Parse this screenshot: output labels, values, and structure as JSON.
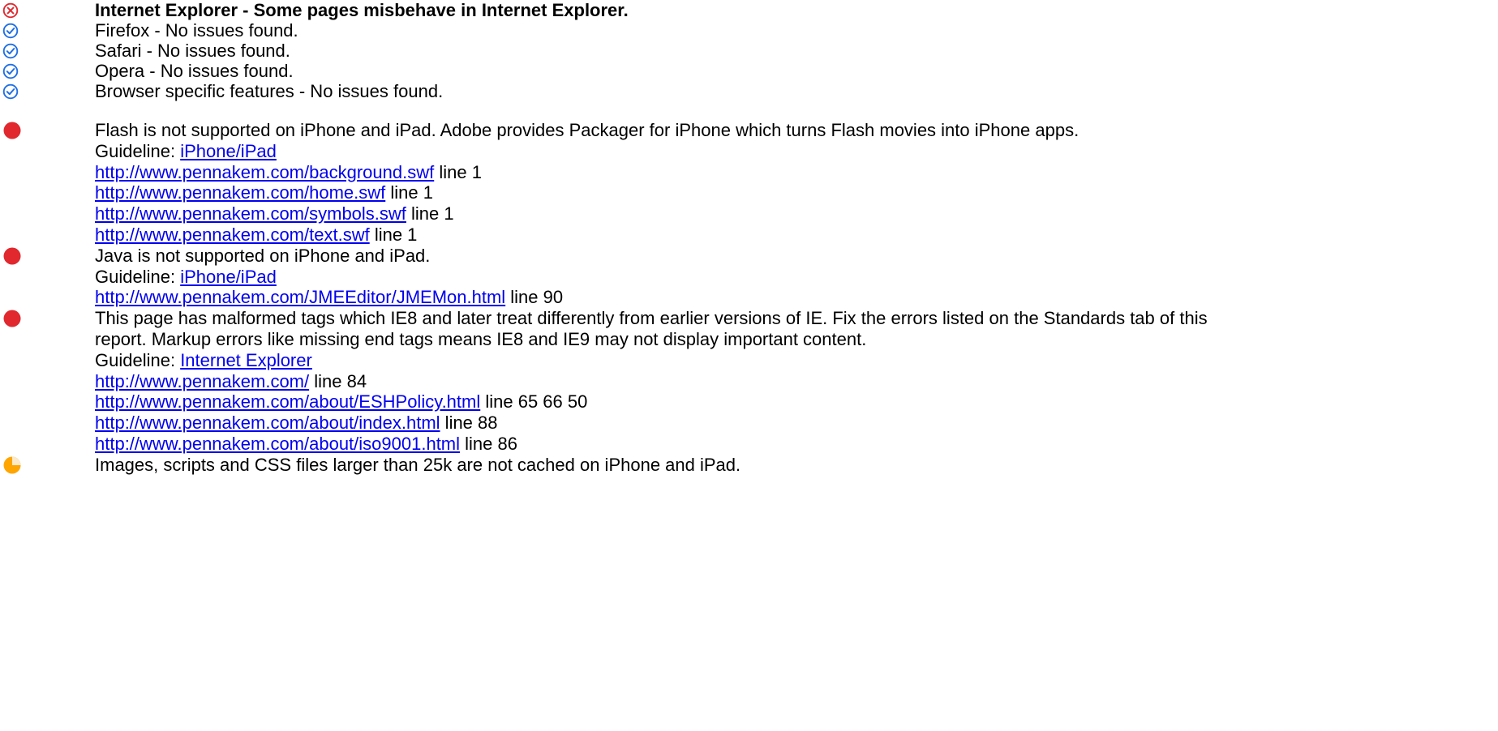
{
  "colors": {
    "error": "#e0282e",
    "ok": "#1f6fe5",
    "link": "#0000ee",
    "warning": "#ffa500"
  },
  "summary": [
    {
      "icon": "error-circle-x-icon",
      "text": "Internet Explorer - Some pages misbehave in Internet Explorer.",
      "bold": true
    },
    {
      "icon": "ok-check-icon",
      "text": "Firefox - No issues found.",
      "bold": false
    },
    {
      "icon": "ok-check-icon",
      "text": "Safari - No issues found.",
      "bold": false
    },
    {
      "icon": "ok-check-icon",
      "text": "Opera - No issues found.",
      "bold": false
    },
    {
      "icon": "ok-check-icon",
      "text": "Browser specific features - No issues found.",
      "bold": false
    }
  ],
  "issues": [
    {
      "severity_icon": "red-dot-icon",
      "description": "Flash is not supported on iPhone and iPad. Adobe provides Packager for iPhone which turns Flash movies into iPhone apps.",
      "guideline_label": "Guideline: ",
      "guideline_link": "iPhone/iPad ",
      "pages": [
        {
          "url": "http://www.pennakem.com/background.swf",
          "lines": " line 1"
        },
        {
          "url": "http://www.pennakem.com/home.swf",
          "lines": " line 1"
        },
        {
          "url": "http://www.pennakem.com/symbols.swf",
          "lines": " line 1"
        },
        {
          "url": "http://www.pennakem.com/text.swf",
          "lines": " line 1"
        }
      ]
    },
    {
      "severity_icon": "red-dot-icon",
      "description": "Java is not supported on iPhone and iPad.",
      "guideline_label": "Guideline: ",
      "guideline_link": "iPhone/iPad ",
      "pages": [
        {
          "url": "http://www.pennakem.com/JMEEditor/JMEMon.html",
          "lines": " line 90"
        }
      ]
    },
    {
      "severity_icon": "red-dot-icon",
      "description": "This page has malformed tags which IE8 and later treat differently from earlier versions of IE. Fix the errors listed on the Standards tab of this report. Markup errors like missing end tags means IE8 and IE9 may not display important content.",
      "guideline_label": "Guideline: ",
      "guideline_link": "Internet Explorer ",
      "pages": [
        {
          "url": "http://www.pennakem.com/",
          "lines": " line 84"
        },
        {
          "url": "http://www.pennakem.com/about/ESHPolicy.html",
          "lines": " line 65 66 50"
        },
        {
          "url": "http://www.pennakem.com/about/index.html",
          "lines": " line 88"
        },
        {
          "url": "http://www.pennakem.com/about/iso9001.html",
          "lines": " line 86"
        }
      ]
    },
    {
      "severity_icon": "orange-pie-icon",
      "description": "Images, scripts and CSS files larger than 25k are not cached on iPhone and iPad.",
      "guideline_label": "",
      "guideline_link": "",
      "pages": []
    }
  ]
}
